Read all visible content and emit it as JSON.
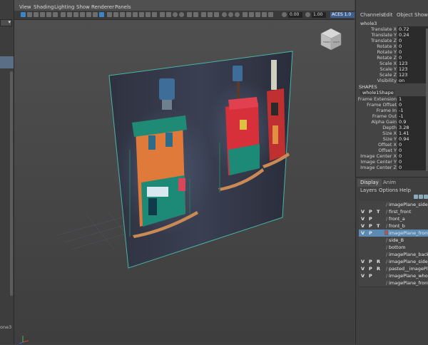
{
  "left": {
    "bottom_label": "one3"
  },
  "viewport": {
    "menu": [
      "View",
      "Shading",
      "Lighting",
      "Show",
      "Renderer",
      "Panels"
    ],
    "toolbar": {
      "exposure": "0.00",
      "gamma": "1.00",
      "color_space": "ACES 1.0"
    },
    "view_cube": {
      "face_front": "FRONT",
      "face_right": "RIGHT"
    }
  },
  "channel_box": {
    "menu": [
      "Channels",
      "Edit",
      "Object",
      "Show"
    ],
    "node": "whole3",
    "attributes": [
      {
        "label": "Translate X",
        "value": "0.72"
      },
      {
        "label": "Translate Y",
        "value": "0.24"
      },
      {
        "label": "Translate Z",
        "value": "0"
      },
      {
        "label": "Rotate X",
        "value": "0"
      },
      {
        "label": "Rotate Y",
        "value": "0"
      },
      {
        "label": "Rotate Z",
        "value": "0"
      },
      {
        "label": "Scale X",
        "value": "123"
      },
      {
        "label": "Scale Y",
        "value": "123"
      },
      {
        "label": "Scale Z",
        "value": "123"
      },
      {
        "label": "Visibility",
        "value": "on"
      }
    ],
    "shapes_header": "SHAPES",
    "shape_node": "whole1Shape",
    "shape_attributes": [
      {
        "label": "Frame Extension",
        "value": "1"
      },
      {
        "label": "Frame Offset",
        "value": "0"
      },
      {
        "label": "Frame In",
        "value": "-1"
      },
      {
        "label": "Frame Out",
        "value": "-1"
      },
      {
        "label": "Alpha Gain",
        "value": "0.9"
      },
      {
        "label": "Depth",
        "value": "3.28"
      },
      {
        "label": "Size X",
        "value": "1.41"
      },
      {
        "label": "Size Y",
        "value": "0.94"
      },
      {
        "label": "Offset X",
        "value": "0"
      },
      {
        "label": "Offset Y",
        "value": "0"
      },
      {
        "label": "Image Center X",
        "value": "0"
      },
      {
        "label": "Image Center Y",
        "value": "0"
      },
      {
        "label": "Image Center Z",
        "value": "0"
      }
    ]
  },
  "layer_editor": {
    "tabs": [
      "Display",
      "Anim"
    ],
    "menu": [
      "Layers",
      "Options",
      "Help"
    ],
    "layers": [
      {
        "v": "",
        "p": "",
        "t": "",
        "name": "imagePlane_side_v",
        "selected": false,
        "colored": false
      },
      {
        "v": "V",
        "p": "P",
        "t": "T",
        "name": "first_front",
        "selected": false,
        "colored": false
      },
      {
        "v": "V",
        "p": "P",
        "t": "",
        "name": "front_a",
        "selected": false,
        "colored": false
      },
      {
        "v": "V",
        "p": "P",
        "t": "T",
        "name": "front_b",
        "selected": false,
        "colored": false
      },
      {
        "v": "V",
        "p": "P",
        "t": "",
        "name": "imagePlane_front_",
        "selected": true,
        "colored": true
      },
      {
        "v": "",
        "p": "",
        "t": "",
        "name": "side_B",
        "selected": false,
        "colored": false
      },
      {
        "v": "",
        "p": "",
        "t": "",
        "name": "bottom",
        "selected": false,
        "colored": false
      },
      {
        "v": "",
        "p": "",
        "t": "",
        "name": "imagePlane_back_v",
        "selected": false,
        "colored": false
      },
      {
        "v": "V",
        "p": "P",
        "t": "R",
        "name": "imagePlane_side_v",
        "selected": false,
        "colored": false
      },
      {
        "v": "V",
        "p": "P",
        "t": "R",
        "name": "pasted__imagePlan",
        "selected": false,
        "colored": false
      },
      {
        "v": "V",
        "p": "P",
        "t": "",
        "name": "imagePlane_whole_",
        "selected": false,
        "colored": false
      },
      {
        "v": "",
        "p": "",
        "t": "",
        "name": "imagePlane_front_",
        "selected": false,
        "colored": false
      }
    ]
  }
}
